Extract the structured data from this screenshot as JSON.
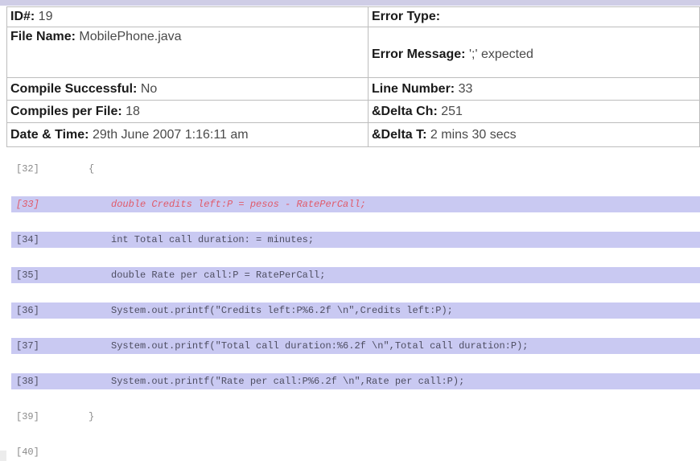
{
  "info": {
    "id": {
      "label": "ID#:",
      "value": " 19"
    },
    "error_type": {
      "label": "Error Type:",
      "value": ""
    },
    "file_name": {
      "label": "File Name:",
      "value": " MobilePhone.java"
    },
    "error_message": {
      "label": "Error Message:",
      "value": " ';' expected"
    },
    "compile_successful": {
      "label": "Compile Successful:",
      "value": " No"
    },
    "line_number": {
      "label": "Line Number:",
      "value": " 33"
    },
    "compiles_per_file": {
      "label": "Compiles per File:",
      "value": " 18"
    },
    "delta_ch": {
      "label": "&Delta Ch:",
      "value": " 251"
    },
    "date_time": {
      "label": "Date & Time:",
      "value": " 29th June 2007 1:16:11 am"
    },
    "delta_t": {
      "label": "&Delta T:",
      "value": " 2 mins 30 secs"
    }
  },
  "code_lines": [
    {
      "num": "[32]",
      "text": "{",
      "highlight": false,
      "error": false
    },
    {
      "num": "[33]",
      "text": "double Credits left:P = pesos - RatePerCall;",
      "highlight": true,
      "error": true
    },
    {
      "num": "[34]",
      "text": "int Total call duration: = minutes;",
      "highlight": true,
      "error": false
    },
    {
      "num": "[35]",
      "text": "double Rate per call:P = RatePerCall;",
      "highlight": true,
      "error": false
    },
    {
      "num": "[36]",
      "text": "System.out.printf(\"Credits left:P%6.2f \\n\",Credits left:P);",
      "highlight": true,
      "error": false
    },
    {
      "num": "[37]",
      "text": "System.out.printf(\"Total call duration:%6.2f \\n\",Total call duration:P);",
      "highlight": true,
      "error": false
    },
    {
      "num": "[38]",
      "text": "System.out.printf(\"Rate per call:P%6.2f \\n\",Rate per call:P);",
      "highlight": true,
      "error": false
    },
    {
      "num": "[39]",
      "text": "}",
      "highlight": false,
      "error": false
    },
    {
      "num": "[40]",
      "text": "",
      "highlight": false,
      "error": false
    }
  ],
  "colors": {
    "highlight": "#c9c9f2",
    "error_text": "#e05a6a",
    "header_bar": "#cfcde6"
  }
}
